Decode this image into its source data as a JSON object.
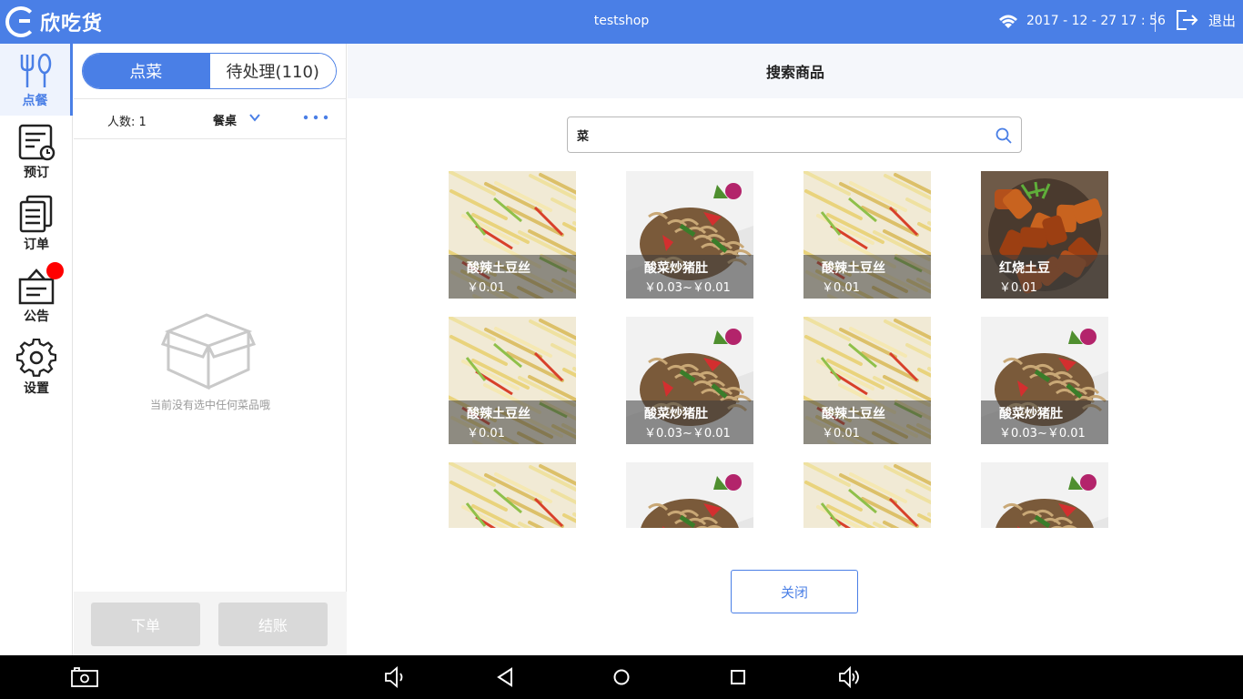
{
  "app": {
    "brand": "欣吃货",
    "shop_name": "testshop",
    "datetime": "2017 - 12 - 27  17 : 56",
    "exit_label": "退出"
  },
  "colors": {
    "accent": "#4a7fe6",
    "badge": "#ff0000"
  },
  "nav": [
    {
      "label": "点餐",
      "icon": "fork-spoon-icon",
      "active": true
    },
    {
      "label": "预订",
      "icon": "reservation-icon",
      "active": false
    },
    {
      "label": "订单",
      "icon": "orders-icon",
      "active": false
    },
    {
      "label": "公告",
      "icon": "announcement-icon",
      "active": false,
      "has_badge": true
    },
    {
      "label": "设置",
      "icon": "gear-icon",
      "active": false
    }
  ],
  "order_panel": {
    "tabs": [
      "点菜",
      "待处理(110)"
    ],
    "people_label": "人数: 1",
    "table_label": "餐桌",
    "empty_text": "当前没有选中任何菜品哦",
    "place_order_label": "下单",
    "checkout_label": "结账"
  },
  "main": {
    "title": "搜索商品",
    "search_value": "菜",
    "close_label": "关闭",
    "dishes": [
      {
        "name": "酸辣土豆丝",
        "price": "￥0.01",
        "img": "potato"
      },
      {
        "name": "酸菜炒猪肚",
        "price": "￥0.03~￥0.01",
        "img": "tripe"
      },
      {
        "name": "酸辣土豆丝",
        "price": "￥0.01",
        "img": "potato"
      },
      {
        "name": "红烧土豆",
        "price": "￥0.01",
        "img": "braised"
      },
      {
        "name": "酸辣土豆丝",
        "price": "￥0.01",
        "img": "potato"
      },
      {
        "name": "酸菜炒猪肚",
        "price": "￥0.03~￥0.01",
        "img": "tripe"
      },
      {
        "name": "酸辣土豆丝",
        "price": "￥0.01",
        "img": "potato"
      },
      {
        "name": "酸菜炒猪肚",
        "price": "￥0.03~￥0.01",
        "img": "tripe"
      },
      {
        "name": "",
        "price": "",
        "img": "potato"
      },
      {
        "name": "",
        "price": "",
        "img": "tripe"
      },
      {
        "name": "",
        "price": "",
        "img": "potato"
      },
      {
        "name": "",
        "price": "",
        "img": "tripe"
      }
    ]
  },
  "system_bar": [
    "screenshot-icon",
    "volume-down-icon",
    "back-icon",
    "home-icon",
    "recents-icon",
    "volume-up-icon"
  ]
}
